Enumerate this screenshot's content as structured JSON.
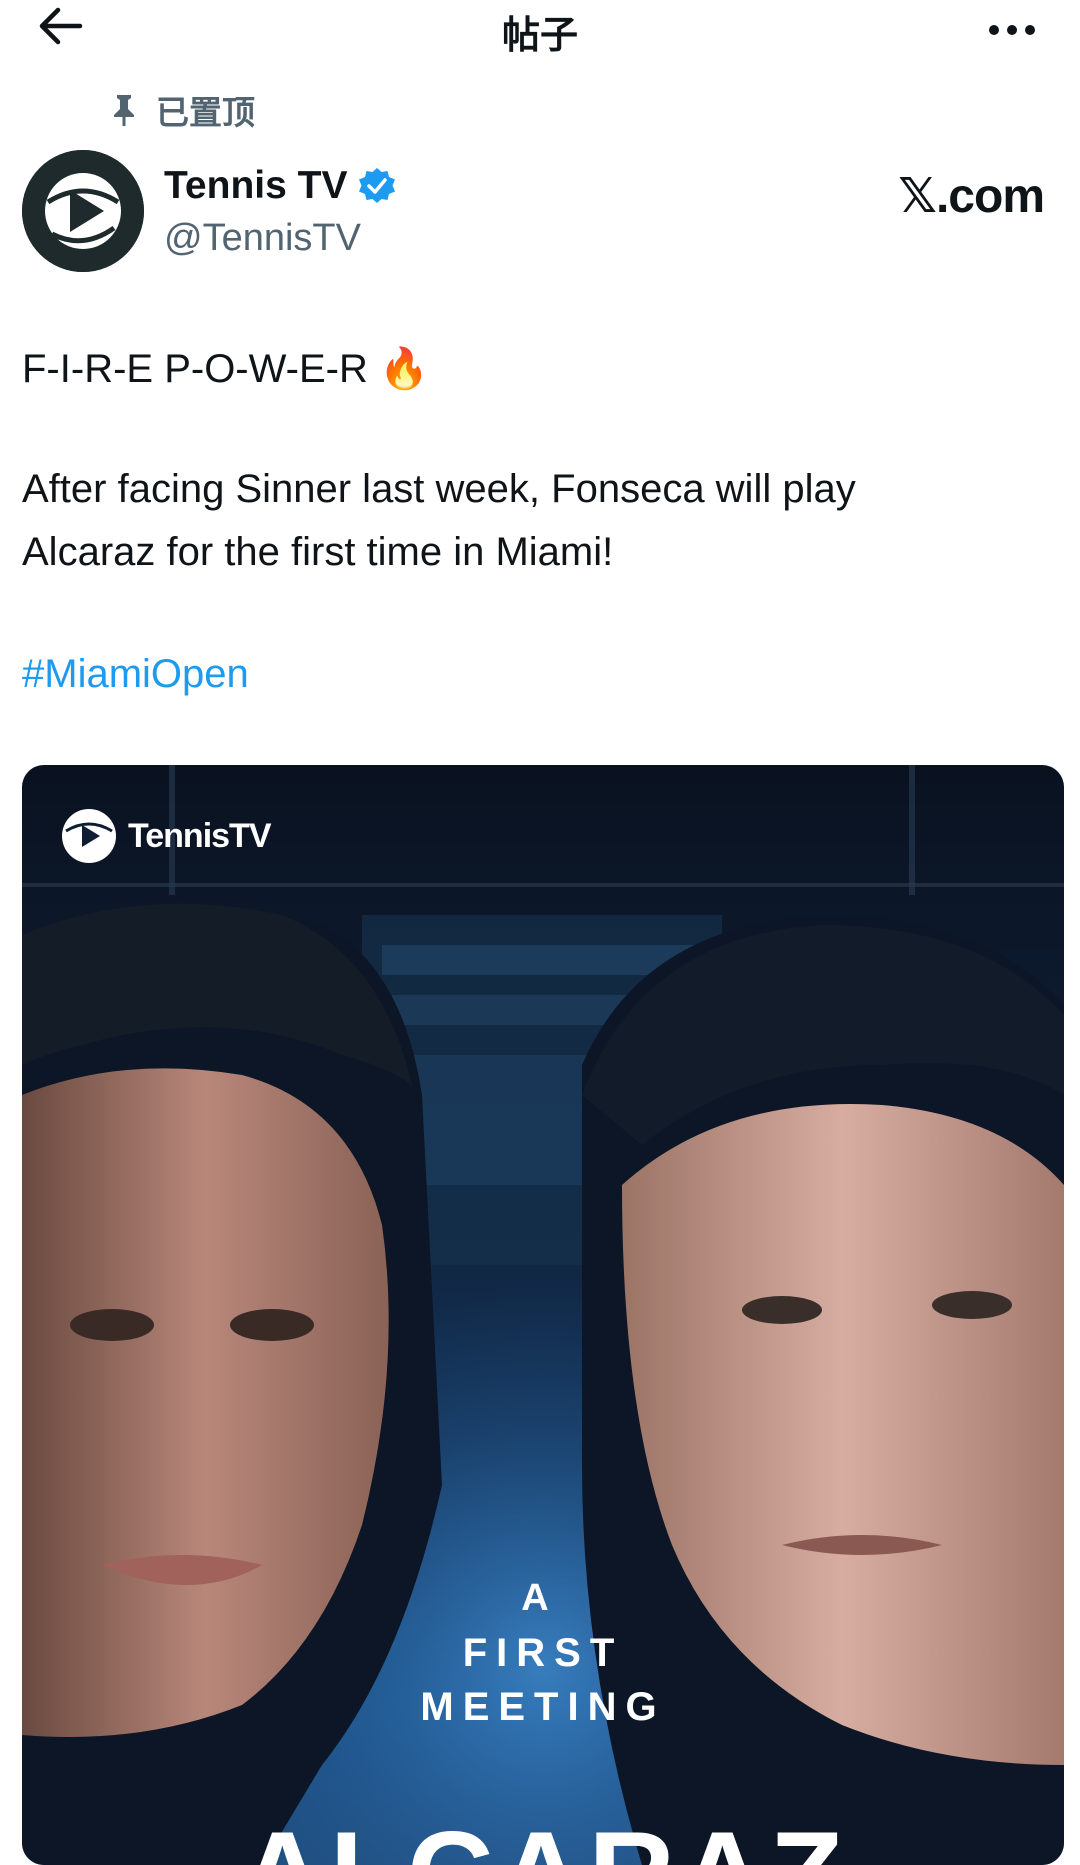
{
  "header": {
    "title": "帖子",
    "back_icon": "arrow-left-icon",
    "more_icon": "more-horizontal-icon"
  },
  "pinned": {
    "label": "已置顶",
    "icon": "pin-icon"
  },
  "author": {
    "name": "Tennis TV",
    "handle": "@TennisTV",
    "verified": true,
    "verified_color": "#1d9bf0"
  },
  "watermark": "𝕏.com",
  "post": {
    "line1": "F-I-R-E P-O-W-E-R 🔥",
    "line2": "After facing Sinner last week, Fonseca will play",
    "line3": "Alcaraz for the first time in Miami!",
    "hashtag": "#MiamiOpen",
    "hashtag_color": "#1d9bf0"
  },
  "media": {
    "logo_text": "TennisTV",
    "overlay_a": "A",
    "overlay_first": "FIRST",
    "overlay_meeting": "MEETING",
    "overlay_name": "ALCARAZ"
  }
}
